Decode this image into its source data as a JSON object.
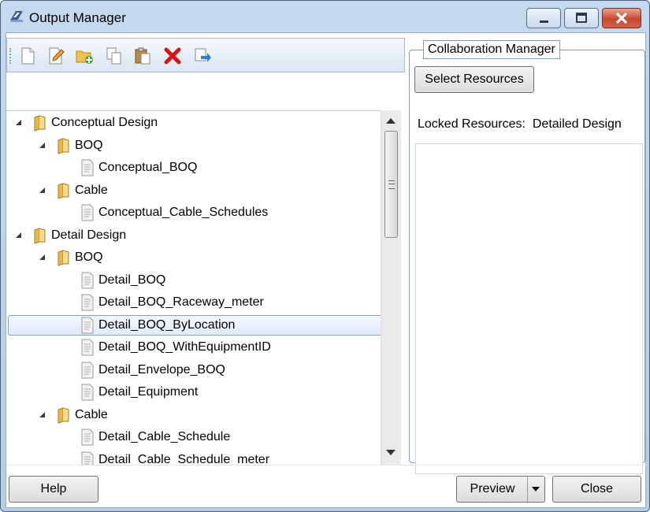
{
  "window": {
    "title": "Output Manager"
  },
  "toolbar": {
    "icons": [
      "new-file-icon",
      "edit-icon",
      "add-folder-icon",
      "copy-icon",
      "paste-icon",
      "delete-icon",
      "export-icon"
    ]
  },
  "tree": {
    "nodes": [
      {
        "label": "Conceptual Design",
        "type": "folder",
        "level": 0,
        "expanded": true
      },
      {
        "label": "BOQ",
        "type": "folder",
        "level": 1,
        "expanded": true
      },
      {
        "label": "Conceptual_BOQ",
        "type": "file",
        "level": 2
      },
      {
        "label": "Cable",
        "type": "folder",
        "level": 1,
        "expanded": true
      },
      {
        "label": "Conceptual_Cable_Schedules",
        "type": "file",
        "level": 2
      },
      {
        "label": "Detail Design",
        "type": "folder",
        "level": 0,
        "expanded": true
      },
      {
        "label": "BOQ",
        "type": "folder",
        "level": 1,
        "expanded": true
      },
      {
        "label": "Detail_BOQ",
        "type": "file",
        "level": 2
      },
      {
        "label": "Detail_BOQ_Raceway_meter",
        "type": "file",
        "level": 2
      },
      {
        "label": "Detail_BOQ_ByLocation",
        "type": "file",
        "level": 2,
        "selected": true
      },
      {
        "label": "Detail_BOQ_WithEquipmentID",
        "type": "file",
        "level": 2
      },
      {
        "label": "Detail_Envelope_BOQ",
        "type": "file",
        "level": 2
      },
      {
        "label": "Detail_Equipment",
        "type": "file",
        "level": 2
      },
      {
        "label": "Cable",
        "type": "folder",
        "level": 1,
        "expanded": true
      },
      {
        "label": "Detail_Cable_Schedule",
        "type": "file",
        "level": 2
      },
      {
        "label": "Detail_Cable_Schedule_meter",
        "type": "file",
        "level": 2
      }
    ]
  },
  "collab": {
    "legend": "Collaboration Manager",
    "select_resources": "Select Resources",
    "locked_label": "Locked Resources:",
    "locked_value": "Detailed Design"
  },
  "footer": {
    "help": "Help",
    "preview": "Preview",
    "close": "Close"
  }
}
